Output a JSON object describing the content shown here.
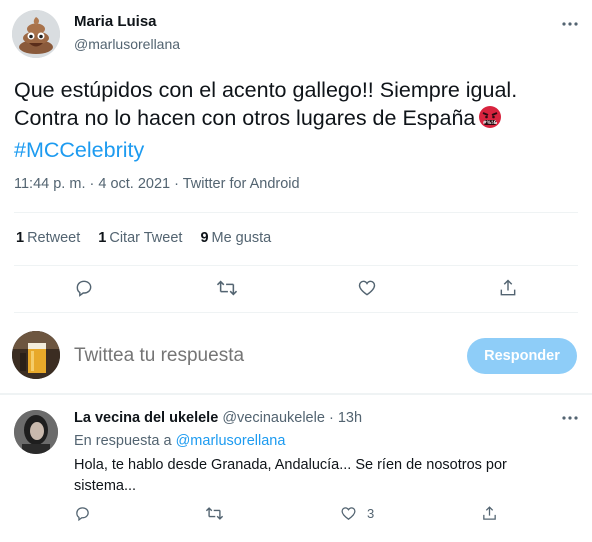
{
  "tweet": {
    "author_name": "Maria Luisa",
    "author_handle": "@marlusorellana",
    "text_line1": "Que estúpidos con el acento gallego!! Siempre igual.",
    "text_line2": "Contra no lo hacen con otros lugares de España",
    "hashtag": "#MCCelebrity",
    "meta": "11:44 p. m. · 4 oct. 2021 · Twitter for Android",
    "stats": {
      "retweets_count": "1",
      "retweets_label": "Retweet",
      "quotes_count": "1",
      "quotes_label": "Citar Tweet",
      "likes_count": "9",
      "likes_label": "Me gusta"
    }
  },
  "composer": {
    "placeholder": "Twittea tu respuesta",
    "button_label": "Responder"
  },
  "reply": {
    "name": "La vecina del ukelele",
    "handle": "@vecinaukelele",
    "separator": "·",
    "time": "13h",
    "replying_to_label": "En respuesta a",
    "replying_to_handle": "@marlusorellana",
    "text": "Hola, te hablo desde Granada, Andalucía... Se ríen de nosotros por sistema...",
    "like_count": "3"
  },
  "colors": {
    "accent": "#1d9bf0",
    "button_disabled": "#8ecdf8",
    "secondary_text": "#536471",
    "primary_text": "#0f1419"
  },
  "icons": [
    "more-icon",
    "reply-icon",
    "retweet-icon",
    "like-icon",
    "share-icon",
    "angry-emoji-icon"
  ]
}
